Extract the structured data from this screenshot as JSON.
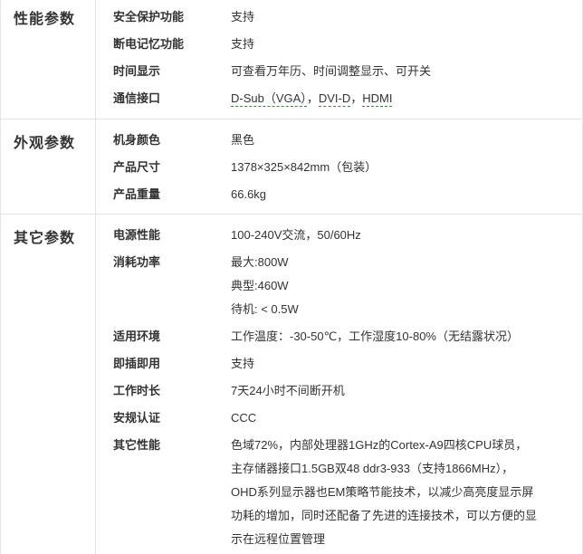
{
  "sections": [
    {
      "title": "性能参数",
      "rows": [
        {
          "label": "安全保护功能",
          "value": "支持"
        },
        {
          "label": "断电记忆功能",
          "value": "支持"
        },
        {
          "label": "时间显示",
          "value": "可查看万年历、时间调整显示、可开关"
        },
        {
          "label": "通信接口",
          "parts": [
            "D-Sub（VGA）",
            "，",
            "DVI-D",
            "，",
            "HDMI"
          ]
        }
      ]
    },
    {
      "title": "外观参数",
      "rows": [
        {
          "label": "机身颜色",
          "value": "黑色"
        },
        {
          "label": "产品尺寸",
          "value": "1378×325×842mm（包装）"
        },
        {
          "label": "产品重量",
          "value": "66.6kg"
        }
      ]
    },
    {
      "title": "其它参数",
      "rows": [
        {
          "label": "电源性能",
          "value": "100-240V交流，50/60Hz"
        },
        {
          "label": "消耗功率",
          "lines": [
            "最大:800W",
            "典型:460W",
            "待机: < 0.5W"
          ]
        },
        {
          "label": "适用环境",
          "value": "工作温度：-30-50℃，工作湿度10-80%（无结露状况）"
        },
        {
          "label": "即插即用",
          "value": "支持"
        },
        {
          "label": "工作时长",
          "value": "7天24小时不间断开机"
        },
        {
          "label": "安规认证",
          "value": "CCC"
        },
        {
          "label": "其它性能",
          "lines": [
            "色域72%，内部处理器1GHz的Cortex-A9四核CPU球员，",
            "主存储器接口1.5GB双48 ddr3-933（支持1866MHz），",
            "OHD系列显示器也EM策略节能技术，以减少高亮度显示屏",
            "功耗的增加，同时还配备了先进的连接技术，可以方便的显",
            "示在远程位置管理"
          ]
        }
      ]
    }
  ]
}
